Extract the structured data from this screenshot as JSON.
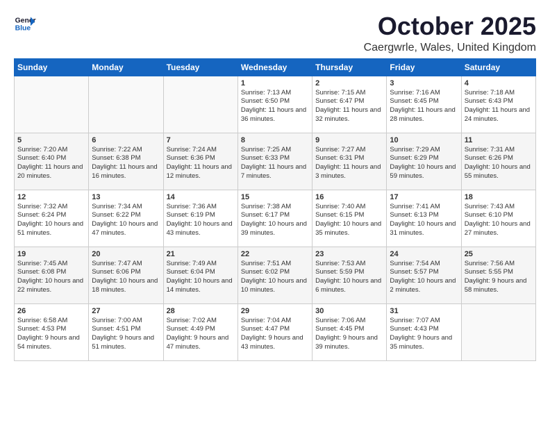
{
  "logo": {
    "line1": "General",
    "line2": "Blue"
  },
  "title": "October 2025",
  "location": "Caergwrle, Wales, United Kingdom",
  "weekdays": [
    "Sunday",
    "Monday",
    "Tuesday",
    "Wednesday",
    "Thursday",
    "Friday",
    "Saturday"
  ],
  "weeks": [
    [
      {
        "day": "",
        "sunrise": "",
        "sunset": "",
        "daylight": ""
      },
      {
        "day": "",
        "sunrise": "",
        "sunset": "",
        "daylight": ""
      },
      {
        "day": "",
        "sunrise": "",
        "sunset": "",
        "daylight": ""
      },
      {
        "day": "1",
        "sunrise": "Sunrise: 7:13 AM",
        "sunset": "Sunset: 6:50 PM",
        "daylight": "Daylight: 11 hours and 36 minutes."
      },
      {
        "day": "2",
        "sunrise": "Sunrise: 7:15 AM",
        "sunset": "Sunset: 6:47 PM",
        "daylight": "Daylight: 11 hours and 32 minutes."
      },
      {
        "day": "3",
        "sunrise": "Sunrise: 7:16 AM",
        "sunset": "Sunset: 6:45 PM",
        "daylight": "Daylight: 11 hours and 28 minutes."
      },
      {
        "day": "4",
        "sunrise": "Sunrise: 7:18 AM",
        "sunset": "Sunset: 6:43 PM",
        "daylight": "Daylight: 11 hours and 24 minutes."
      }
    ],
    [
      {
        "day": "5",
        "sunrise": "Sunrise: 7:20 AM",
        "sunset": "Sunset: 6:40 PM",
        "daylight": "Daylight: 11 hours and 20 minutes."
      },
      {
        "day": "6",
        "sunrise": "Sunrise: 7:22 AM",
        "sunset": "Sunset: 6:38 PM",
        "daylight": "Daylight: 11 hours and 16 minutes."
      },
      {
        "day": "7",
        "sunrise": "Sunrise: 7:24 AM",
        "sunset": "Sunset: 6:36 PM",
        "daylight": "Daylight: 11 hours and 12 minutes."
      },
      {
        "day": "8",
        "sunrise": "Sunrise: 7:25 AM",
        "sunset": "Sunset: 6:33 PM",
        "daylight": "Daylight: 11 hours and 7 minutes."
      },
      {
        "day": "9",
        "sunrise": "Sunrise: 7:27 AM",
        "sunset": "Sunset: 6:31 PM",
        "daylight": "Daylight: 11 hours and 3 minutes."
      },
      {
        "day": "10",
        "sunrise": "Sunrise: 7:29 AM",
        "sunset": "Sunset: 6:29 PM",
        "daylight": "Daylight: 10 hours and 59 minutes."
      },
      {
        "day": "11",
        "sunrise": "Sunrise: 7:31 AM",
        "sunset": "Sunset: 6:26 PM",
        "daylight": "Daylight: 10 hours and 55 minutes."
      }
    ],
    [
      {
        "day": "12",
        "sunrise": "Sunrise: 7:32 AM",
        "sunset": "Sunset: 6:24 PM",
        "daylight": "Daylight: 10 hours and 51 minutes."
      },
      {
        "day": "13",
        "sunrise": "Sunrise: 7:34 AM",
        "sunset": "Sunset: 6:22 PM",
        "daylight": "Daylight: 10 hours and 47 minutes."
      },
      {
        "day": "14",
        "sunrise": "Sunrise: 7:36 AM",
        "sunset": "Sunset: 6:19 PM",
        "daylight": "Daylight: 10 hours and 43 minutes."
      },
      {
        "day": "15",
        "sunrise": "Sunrise: 7:38 AM",
        "sunset": "Sunset: 6:17 PM",
        "daylight": "Daylight: 10 hours and 39 minutes."
      },
      {
        "day": "16",
        "sunrise": "Sunrise: 7:40 AM",
        "sunset": "Sunset: 6:15 PM",
        "daylight": "Daylight: 10 hours and 35 minutes."
      },
      {
        "day": "17",
        "sunrise": "Sunrise: 7:41 AM",
        "sunset": "Sunset: 6:13 PM",
        "daylight": "Daylight: 10 hours and 31 minutes."
      },
      {
        "day": "18",
        "sunrise": "Sunrise: 7:43 AM",
        "sunset": "Sunset: 6:10 PM",
        "daylight": "Daylight: 10 hours and 27 minutes."
      }
    ],
    [
      {
        "day": "19",
        "sunrise": "Sunrise: 7:45 AM",
        "sunset": "Sunset: 6:08 PM",
        "daylight": "Daylight: 10 hours and 22 minutes."
      },
      {
        "day": "20",
        "sunrise": "Sunrise: 7:47 AM",
        "sunset": "Sunset: 6:06 PM",
        "daylight": "Daylight: 10 hours and 18 minutes."
      },
      {
        "day": "21",
        "sunrise": "Sunrise: 7:49 AM",
        "sunset": "Sunset: 6:04 PM",
        "daylight": "Daylight: 10 hours and 14 minutes."
      },
      {
        "day": "22",
        "sunrise": "Sunrise: 7:51 AM",
        "sunset": "Sunset: 6:02 PM",
        "daylight": "Daylight: 10 hours and 10 minutes."
      },
      {
        "day": "23",
        "sunrise": "Sunrise: 7:53 AM",
        "sunset": "Sunset: 5:59 PM",
        "daylight": "Daylight: 10 hours and 6 minutes."
      },
      {
        "day": "24",
        "sunrise": "Sunrise: 7:54 AM",
        "sunset": "Sunset: 5:57 PM",
        "daylight": "Daylight: 10 hours and 2 minutes."
      },
      {
        "day": "25",
        "sunrise": "Sunrise: 7:56 AM",
        "sunset": "Sunset: 5:55 PM",
        "daylight": "Daylight: 9 hours and 58 minutes."
      }
    ],
    [
      {
        "day": "26",
        "sunrise": "Sunrise: 6:58 AM",
        "sunset": "Sunset: 4:53 PM",
        "daylight": "Daylight: 9 hours and 54 minutes."
      },
      {
        "day": "27",
        "sunrise": "Sunrise: 7:00 AM",
        "sunset": "Sunset: 4:51 PM",
        "daylight": "Daylight: 9 hours and 51 minutes."
      },
      {
        "day": "28",
        "sunrise": "Sunrise: 7:02 AM",
        "sunset": "Sunset: 4:49 PM",
        "daylight": "Daylight: 9 hours and 47 minutes."
      },
      {
        "day": "29",
        "sunrise": "Sunrise: 7:04 AM",
        "sunset": "Sunset: 4:47 PM",
        "daylight": "Daylight: 9 hours and 43 minutes."
      },
      {
        "day": "30",
        "sunrise": "Sunrise: 7:06 AM",
        "sunset": "Sunset: 4:45 PM",
        "daylight": "Daylight: 9 hours and 39 minutes."
      },
      {
        "day": "31",
        "sunrise": "Sunrise: 7:07 AM",
        "sunset": "Sunset: 4:43 PM",
        "daylight": "Daylight: 9 hours and 35 minutes."
      },
      {
        "day": "",
        "sunrise": "",
        "sunset": "",
        "daylight": ""
      }
    ]
  ]
}
